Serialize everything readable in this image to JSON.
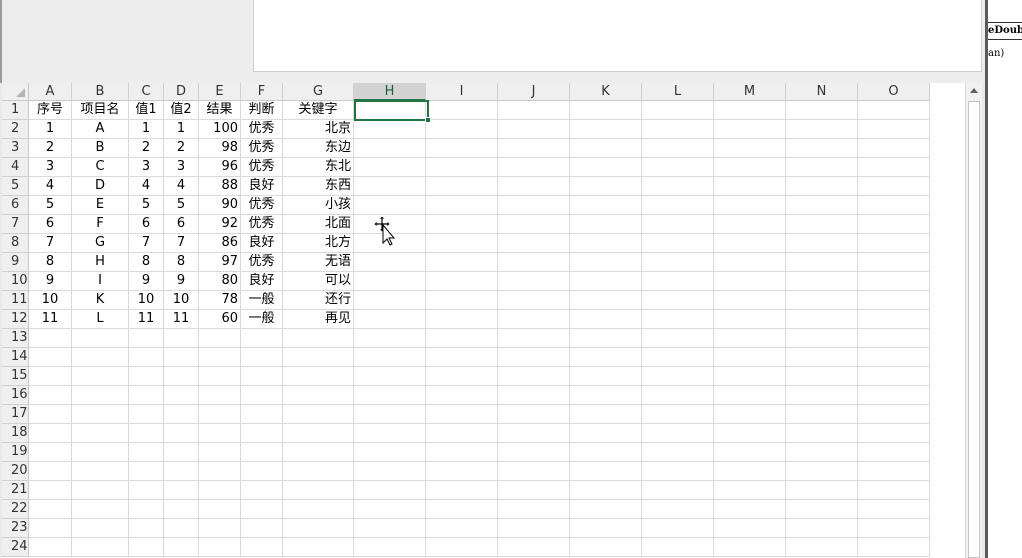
{
  "right_panel": {
    "line1": "eDoubl",
    "line2": "an)"
  },
  "sheet": {
    "columns": [
      "A",
      "B",
      "C",
      "D",
      "E",
      "F",
      "G",
      "H",
      "I",
      "J",
      "K",
      "L",
      "M",
      "N",
      "O"
    ],
    "selected_column": "H",
    "rows": [
      "1",
      "2",
      "3",
      "4",
      "5",
      "6",
      "7",
      "8",
      "9",
      "10",
      "11",
      "12",
      "13",
      "14",
      "15",
      "16",
      "17",
      "18",
      "19",
      "20",
      "21",
      "22",
      "23",
      "24"
    ],
    "header_row": [
      "序号",
      "项目名",
      "值1",
      "值2",
      "结果",
      "判断",
      "关键字"
    ],
    "data_rows": [
      [
        "1",
        "A",
        "1",
        "1",
        "100",
        "优秀",
        "北京"
      ],
      [
        "2",
        "B",
        "2",
        "2",
        "98",
        "优秀",
        "东边"
      ],
      [
        "3",
        "C",
        "3",
        "3",
        "96",
        "优秀",
        "东北"
      ],
      [
        "4",
        "D",
        "4",
        "4",
        "88",
        "良好",
        "东西"
      ],
      [
        "5",
        "E",
        "5",
        "5",
        "90",
        "优秀",
        "小孩"
      ],
      [
        "6",
        "F",
        "6",
        "6",
        "92",
        "优秀",
        "北面"
      ],
      [
        "7",
        "G",
        "7",
        "7",
        "86",
        "良好",
        "北方"
      ],
      [
        "8",
        "H",
        "8",
        "8",
        "97",
        "优秀",
        "无语"
      ],
      [
        "9",
        "I",
        "9",
        "9",
        "80",
        "良好",
        "可以"
      ],
      [
        "10",
        "K",
        "10",
        "10",
        "78",
        "一般",
        "还行"
      ],
      [
        "11",
        "L",
        "11",
        "11",
        "60",
        "一般",
        "再见"
      ]
    ],
    "active_cell": "H1"
  },
  "colors": {
    "selection": "#217346",
    "header_bg": "#efefef",
    "gridline": "#dadada"
  },
  "icons": {
    "cursor": "move-cursor-icon",
    "scroll_up": "arrow-up-icon"
  }
}
